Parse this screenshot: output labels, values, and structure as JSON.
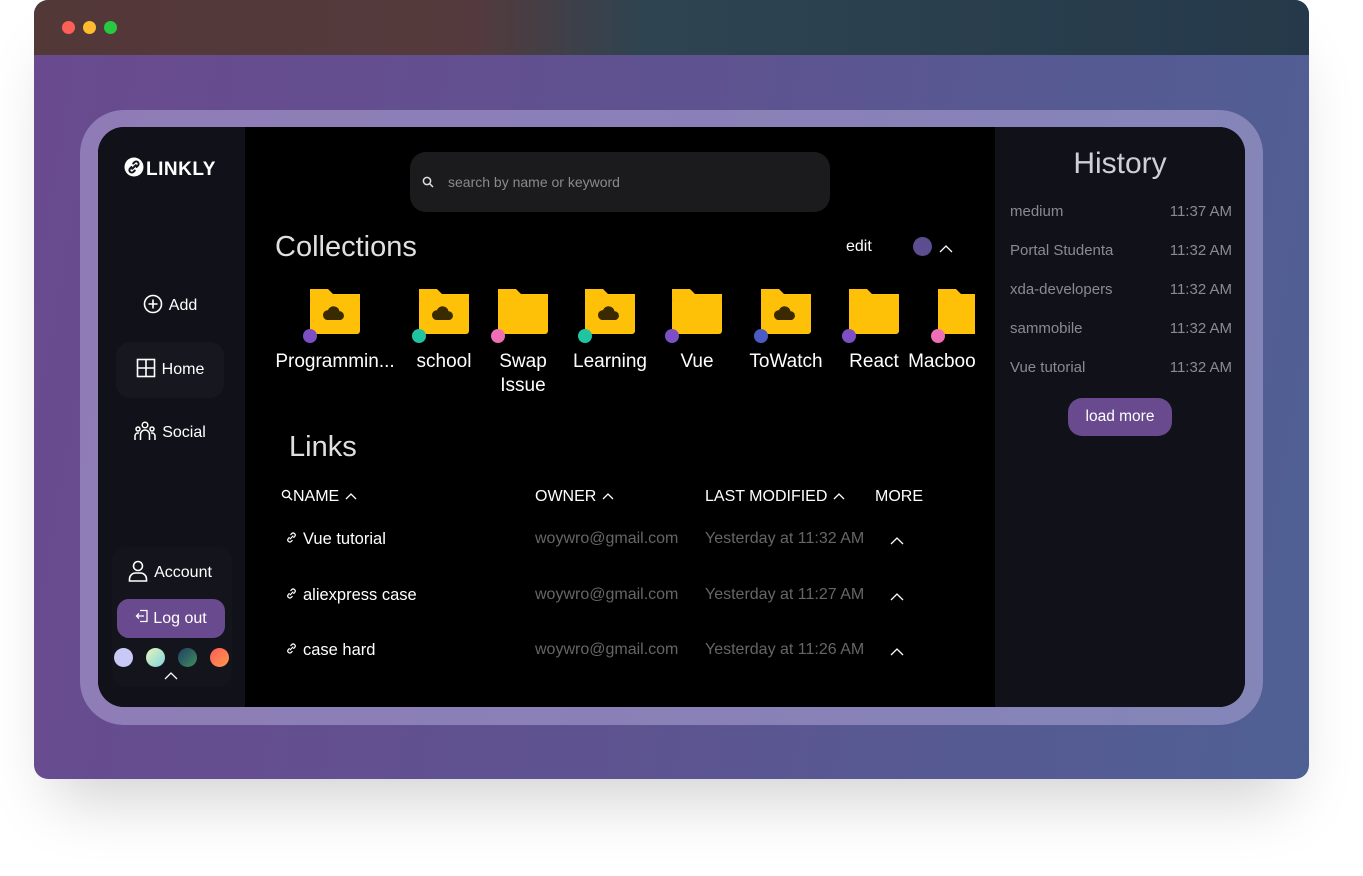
{
  "window": {
    "controls": [
      {
        "name": "close",
        "color": "#ff5f57"
      },
      {
        "name": "minimize",
        "color": "#febc2e"
      },
      {
        "name": "maximize",
        "color": "#28c840"
      }
    ]
  },
  "brand": {
    "name": "LINKLY",
    "icon": "link-icon"
  },
  "nav": {
    "add": {
      "label": "Add",
      "icon": "plus-circle-icon"
    },
    "home": {
      "label": "Home",
      "icon": "grid-icon"
    },
    "social": {
      "label": "Social",
      "icon": "people-icon"
    }
  },
  "account": {
    "label": "Account",
    "icon": "user-icon",
    "logout_label": "Log out",
    "logout_icon": "logout-icon",
    "themes": [
      {
        "name": "lavender",
        "color": "#c9c9f7"
      },
      {
        "name": "mint",
        "color": "#a6e3cc"
      },
      {
        "name": "forest",
        "color": "#2f6b5a"
      },
      {
        "name": "coral",
        "color": "#ff6b5b"
      }
    ]
  },
  "search": {
    "placeholder": "search by name or keyword"
  },
  "collections": {
    "title": "Collections",
    "edit_label": "edit",
    "accent": "#5b4d8f",
    "items": [
      {
        "label": "Programmin...",
        "dot": "#7d4fc4",
        "cloud": true
      },
      {
        "label": "school",
        "dot": "#20c4a0",
        "cloud": true
      },
      {
        "label": "Swap Issue",
        "dot": "#f06fb4",
        "cloud": false
      },
      {
        "label": "Learning",
        "dot": "#20c4a0",
        "cloud": true
      },
      {
        "label": "Vue",
        "dot": "#7d4fc4",
        "cloud": false
      },
      {
        "label": "ToWatch",
        "dot": "#4a5cc4",
        "cloud": true
      },
      {
        "label": "React",
        "dot": "#7d4fc4",
        "cloud": false
      },
      {
        "label": "Macbook A...",
        "dot": "#f06fb4",
        "cloud": false
      }
    ]
  },
  "links": {
    "title": "Links",
    "columns": {
      "name": "NAME",
      "owner": "OWNER",
      "modified": "LAST MODIFIED",
      "more": "MORE"
    },
    "rows": [
      {
        "name": "Vue tutorial",
        "owner": "woywro@gmail.com",
        "modified": "Yesterday at 11:32 AM"
      },
      {
        "name": "aliexpress case",
        "owner": "woywro@gmail.com",
        "modified": "Yesterday at 11:27 AM"
      },
      {
        "name": "case hard",
        "owner": "woywro@gmail.com",
        "modified": "Yesterday at 11:26 AM"
      }
    ]
  },
  "history": {
    "title": "History",
    "items": [
      {
        "name": "medium",
        "time": "11:37 AM"
      },
      {
        "name": "Portal Studenta",
        "time": "11:32 AM"
      },
      {
        "name": "xda-developers",
        "time": "11:32 AM"
      },
      {
        "name": "sammobile",
        "time": "11:32 AM"
      },
      {
        "name": "Vue tutorial",
        "time": "11:32 AM"
      }
    ],
    "load_more_label": "load more"
  },
  "colors": {
    "accent": "#6a4a8f",
    "folder": "#ffc107",
    "sidebar_bg": "#111219",
    "main_bg": "#000000"
  }
}
